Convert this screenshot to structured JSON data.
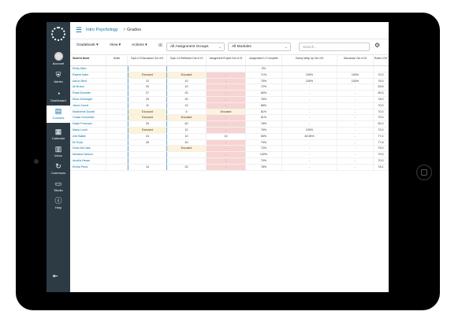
{
  "colors": {
    "nav_bg": "#2d3b45",
    "accent": "#0770a3",
    "excused": "#fdf3d9",
    "missing": "#f7d3d2"
  },
  "nav": [
    {
      "label": "Account",
      "icon": "avatar-icon"
    },
    {
      "label": "Admin",
      "icon": "shield-icon"
    },
    {
      "label": "Dashboard",
      "icon": "dashboard-icon"
    },
    {
      "label": "Courses",
      "icon": "book-icon",
      "active": true
    },
    {
      "label": "Calendar",
      "icon": "calendar-icon"
    },
    {
      "label": "Inbox",
      "icon": "inbox-icon"
    },
    {
      "label": "Commons",
      "icon": "commons-icon"
    },
    {
      "label": "Studio",
      "icon": "studio-icon"
    },
    {
      "label": "Help",
      "icon": "help-icon"
    }
  ],
  "breadcrumb": {
    "course": "Intro Psychology",
    "separator": ">",
    "page": "Grades"
  },
  "toolbar": {
    "gradebook": "Gradebook ▾",
    "view": "View ▾",
    "actions": "Actions ▾",
    "groups": "All Assignment Groups",
    "modules": "All Modules",
    "search_placeholder": "Search..."
  },
  "grid": {
    "headers": [
      "Student Name",
      "Notes",
      "Topic 4.3 Discussion Out of 5",
      "Topic 4.4 Reflection Out of 10",
      "Assignment Project Out of 15",
      "Assignment 1.0 Complete",
      "Survey Wrap Up Out of 5",
      "Discussion Out of 10",
      "Rubric 10%"
    ],
    "rows": [
      {
        "name": "Emily Allen",
        "cells": [
          "",
          "",
          "",
          "",
          "0%",
          "",
          "",
          ""
        ]
      },
      {
        "name": "Rachel Adler",
        "cells": [
          "Excused",
          "Excused",
          "-",
          "71%",
          "100%",
          "100%",
          "70.0"
        ]
      },
      {
        "name": "Aaron Bent",
        "cells": [
          "12",
          "10",
          "-",
          "75%",
          "100%",
          "100%",
          "76.0"
        ]
      },
      {
        "name": "Ali Brand",
        "cells": [
          "20",
          "10",
          "-",
          "72%",
          "-",
          "-",
          "69.5"
        ]
      },
      {
        "name": "Rosa Burnette",
        "cells": [
          "27",
          "20",
          "-",
          "80%",
          "-",
          "-",
          "80.5"
        ]
      },
      {
        "name": "Elisa Cheninger",
        "cells": [
          "20",
          "20",
          "-",
          "76%",
          "-",
          "-",
          "78.0"
        ]
      },
      {
        "name": "Jason Currie",
        "cells": [
          "11",
          "10",
          "-",
          "66%",
          "-",
          "-",
          "70.0"
        ]
      },
      {
        "name": "Madeleine Dowlin",
        "cells": [
          "Excused",
          "5",
          "Excused",
          "81%",
          "-",
          "-",
          "70.0"
        ]
      },
      {
        "name": "Chase Donnellan",
        "cells": [
          "Excused",
          "Excused",
          "-",
          "81%",
          "-",
          "-",
          "70.0"
        ]
      },
      {
        "name": "Dayle Freeman",
        "cells": [
          "29",
          "40",
          "-",
          "78%",
          "-",
          "-",
          "82.0"
        ]
      },
      {
        "name": "Maria Lucid",
        "cells": [
          "Excused",
          "10",
          "-",
          "79%",
          "100%",
          "-",
          "70.0"
        ]
      },
      {
        "name": "Zed Bailee",
        "cells": [
          "24",
          "10",
          "10",
          "65%",
          "40.55%",
          "-",
          "77.2"
        ]
      },
      {
        "name": "Eli Rock",
        "cells": [
          "29",
          "20",
          "-",
          "79%",
          "-",
          "-",
          "77.8"
        ]
      },
      {
        "name": "Drew McCabe",
        "cells": [
          "",
          "Excused",
          "-",
          "72%",
          "-",
          "-",
          "75.0"
        ]
      },
      {
        "name": "Meadow Nelson",
        "cells": [
          "",
          "",
          "-",
          "100%",
          "-",
          "-",
          "70.0"
        ]
      },
      {
        "name": "Amelia Hesse",
        "cells": [
          "",
          "",
          "-",
          "70%",
          "-",
          "-",
          "70.0"
        ]
      },
      {
        "name": "Emilia Pena",
        "cells": [
          "14",
          "20",
          "-",
          "78%",
          "-",
          "-",
          "78.1"
        ]
      }
    ]
  }
}
